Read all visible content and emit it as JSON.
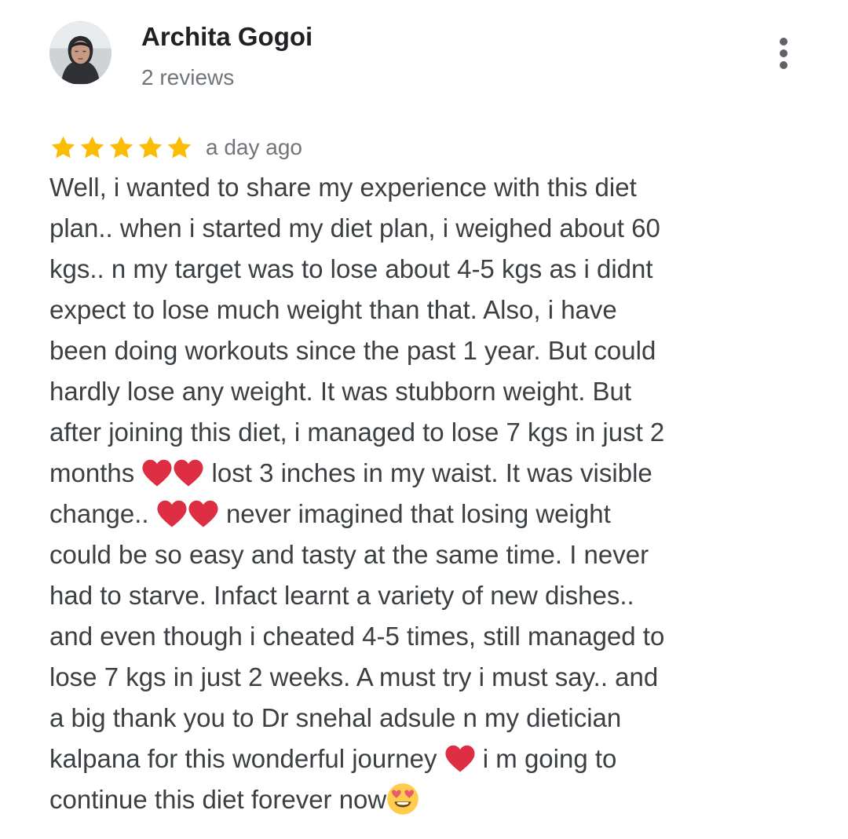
{
  "review": {
    "author": {
      "name": "Archita Gogoi",
      "review_count": "2 reviews",
      "avatar_icon": "user-avatar-photo"
    },
    "menu_icon": "more-vertical-icon",
    "rating": {
      "stars": 5,
      "max_stars": 5,
      "star_color": "#fbbc04"
    },
    "date": "a day ago",
    "text_lines": [
      {
        "parts": [
          "Well, i wanted to share my experience with this diet"
        ]
      },
      {
        "parts": [
          "plan.. when i started my diet plan, i weighed about 60"
        ]
      },
      {
        "parts": [
          "kgs.. n my target was to lose about 4-5 kgs as i didnt"
        ]
      },
      {
        "parts": [
          "expect to lose much weight than that. Also, i have"
        ]
      },
      {
        "parts": [
          "been doing workouts since the past 1 year. But could"
        ]
      },
      {
        "parts": [
          "hardly lose any weight. It was stubborn weight. But"
        ]
      },
      {
        "parts": [
          "after joining this diet, i managed to lose 7 kgs in just 2"
        ]
      },
      {
        "parts": [
          "months ",
          "heart",
          "heart",
          " lost 3 inches in my waist. It was visible"
        ]
      },
      {
        "parts": [
          "change.. ",
          "heart",
          "heart",
          " never imagined that losing weight"
        ]
      },
      {
        "parts": [
          "could be so easy and tasty at the same time. I never"
        ]
      },
      {
        "parts": [
          "had to starve. Infact learnt a variety of new dishes.."
        ]
      },
      {
        "parts": [
          "and even though i cheated 4-5 times, still managed to"
        ]
      },
      {
        "parts": [
          "lose 7 kgs in just 2 weeks. A must try i must say.. and"
        ]
      },
      {
        "parts": [
          "a big thank you to Dr snehal adsule n my dietician"
        ]
      },
      {
        "parts": [
          "kalpana for this wonderful journey ",
          "heart",
          " i m going to"
        ]
      },
      {
        "parts": [
          "continue this diet forever now",
          "smiling-face-with-heart-eyes"
        ]
      }
    ],
    "emoji_colors": {
      "heart": "#dd2e44",
      "smiley_face": "#ffcc4d",
      "smiley_features": "#664500",
      "smiley_hearts": "#e75a70"
    }
  }
}
